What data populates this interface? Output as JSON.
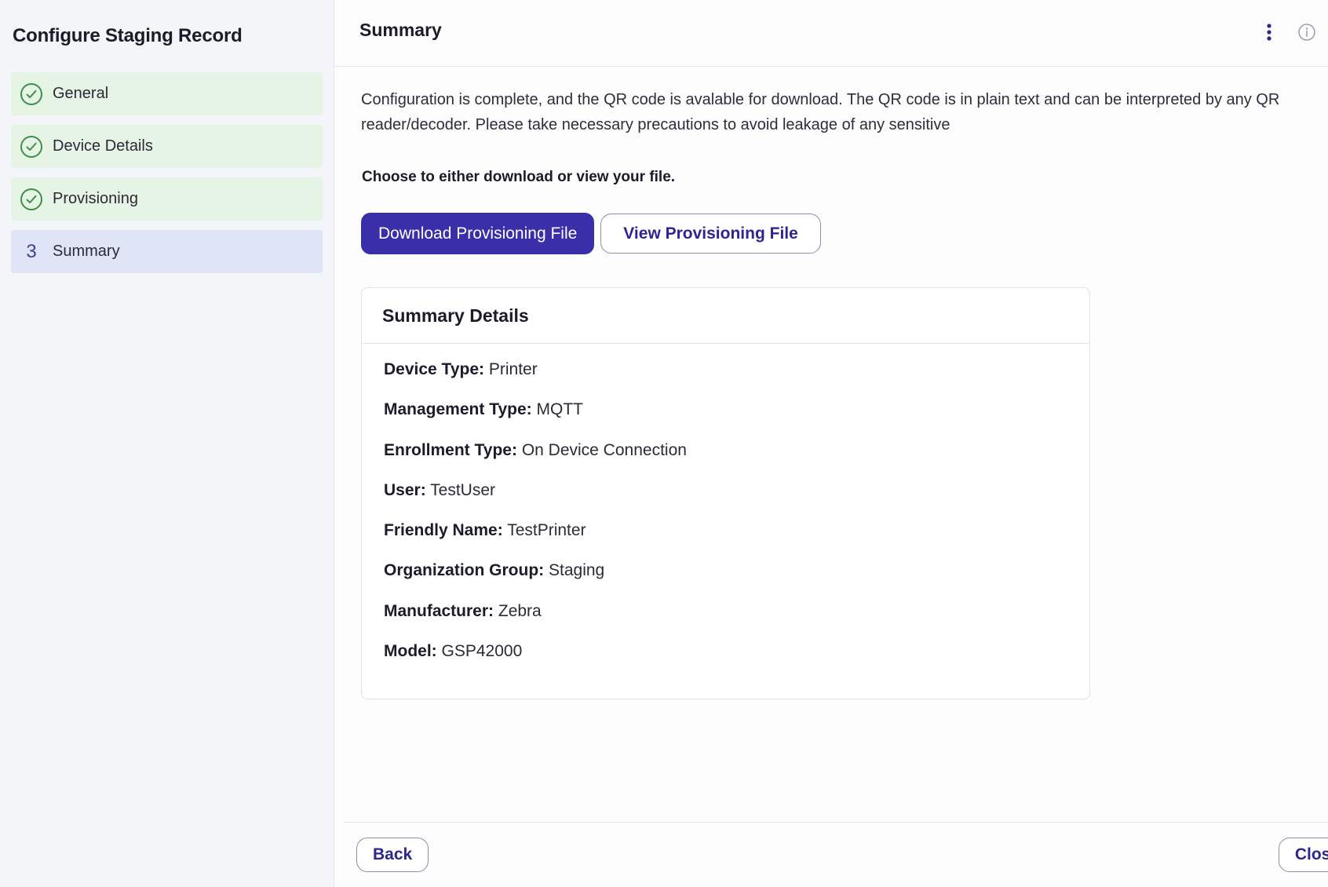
{
  "sidebar": {
    "title": "Configure Staging Record",
    "steps": [
      {
        "label": "General",
        "state": "done"
      },
      {
        "label": "Device Details",
        "state": "done"
      },
      {
        "label": "Provisioning",
        "state": "done"
      },
      {
        "label": "Summary",
        "state": "active",
        "number": "3"
      }
    ]
  },
  "header": {
    "title": "Summary",
    "icons": [
      "kebab-menu-icon",
      "info-icon",
      "close-icon"
    ]
  },
  "content": {
    "intro": "Configuration is complete, and the QR code is avalable for download. The QR code is in plain text and can be interpreted by any QR reader/decoder. Please take necessary precautions to avoid leakage of any sensitive",
    "choose": "Choose to either download or view your file.",
    "download_label": "Download Provisioning File",
    "view_label": "View Provisioning File"
  },
  "summary": {
    "title": "Summary Details",
    "rows": [
      {
        "key": "Device Type:",
        "value": "Printer"
      },
      {
        "key": "Management Type:",
        "value": "MQTT"
      },
      {
        "key": "Enrollment Type:",
        "value": "On Device Connection"
      },
      {
        "key": "User:",
        "value": "TestUser"
      },
      {
        "key": "Friendly Name:",
        "value": "TestPrinter"
      },
      {
        "key": "Organization Group:",
        "value": "Staging"
      },
      {
        "key": "Manufacturer:",
        "value": "Zebra"
      },
      {
        "key": "Model:",
        "value": "GSP42000"
      }
    ]
  },
  "footer": {
    "back_label": "Back",
    "close_label": "Close"
  },
  "colors": {
    "primary": "#3a2fa8",
    "step_done_bg": "#e6f4e6",
    "step_active_bg": "#dfe4f6",
    "check_green": "#3f8f4a"
  }
}
